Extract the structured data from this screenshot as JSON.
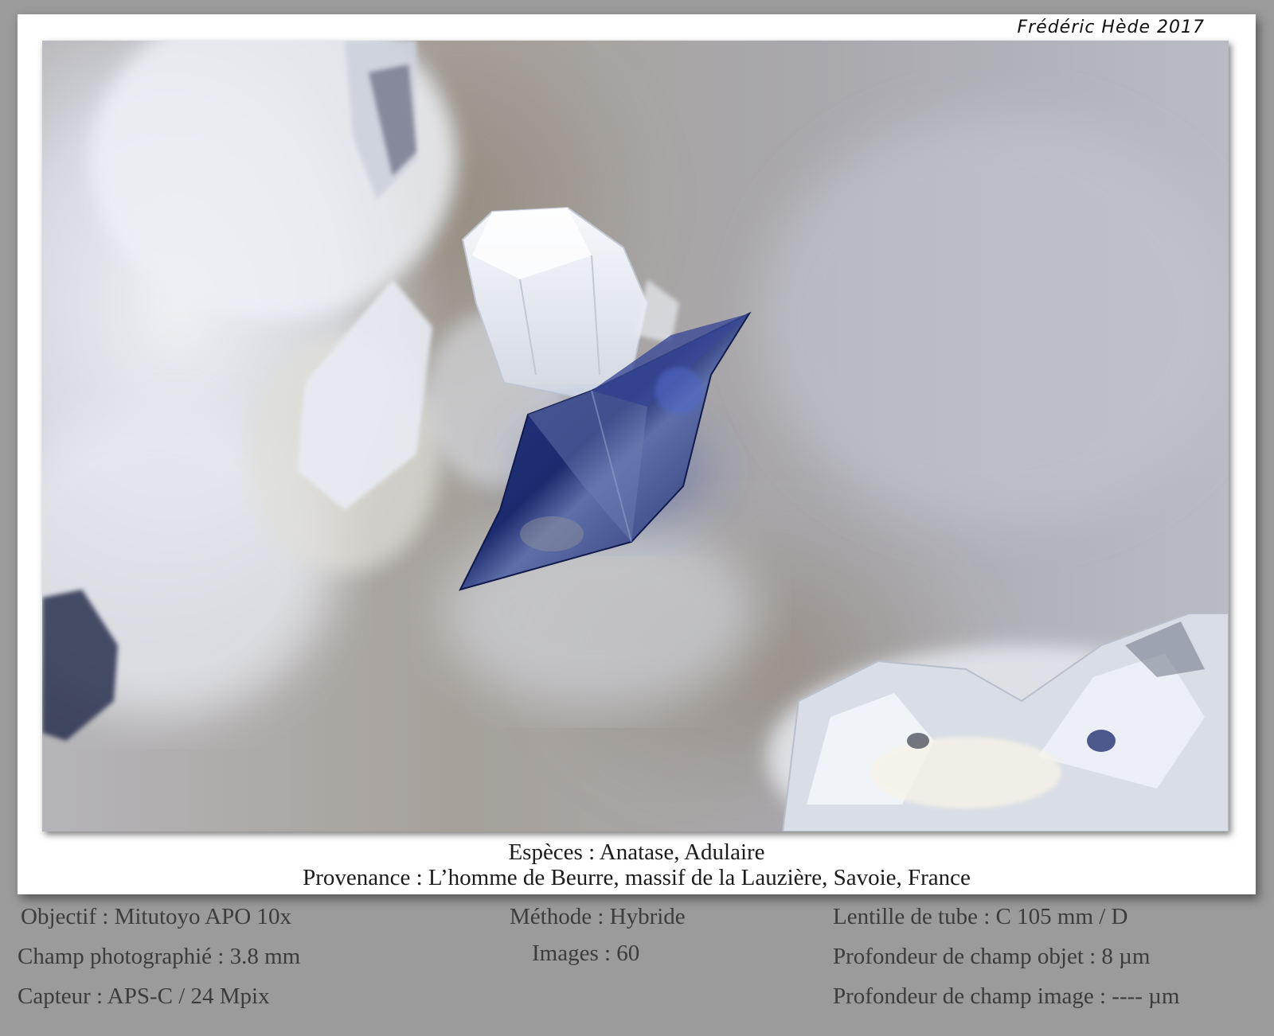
{
  "signature": "Frédéric Hède 2017",
  "caption": {
    "species": "Espèces : Anatase, Adulaire",
    "origin": "Provenance : L’homme de Beurre, massif de la Lauzière, Savoie, France"
  },
  "info": {
    "left": [
      "Objectif : Mitutoyo APO 10x",
      "Champ photographié : 3.8 mm",
      "Capteur : APS-C / 24 Mpix"
    ],
    "middle": [
      "Méthode : Hybride",
      "Images : 60"
    ],
    "right": [
      "Lentille de tube : C 105 mm / D",
      "Profondeur de champ objet : 8 µm",
      "Profondeur de champ image : ---- µm"
    ]
  },
  "colors": {
    "background": "#9b9b9b",
    "card": "#ffffff",
    "crystal_blue": "#1f2f78"
  }
}
